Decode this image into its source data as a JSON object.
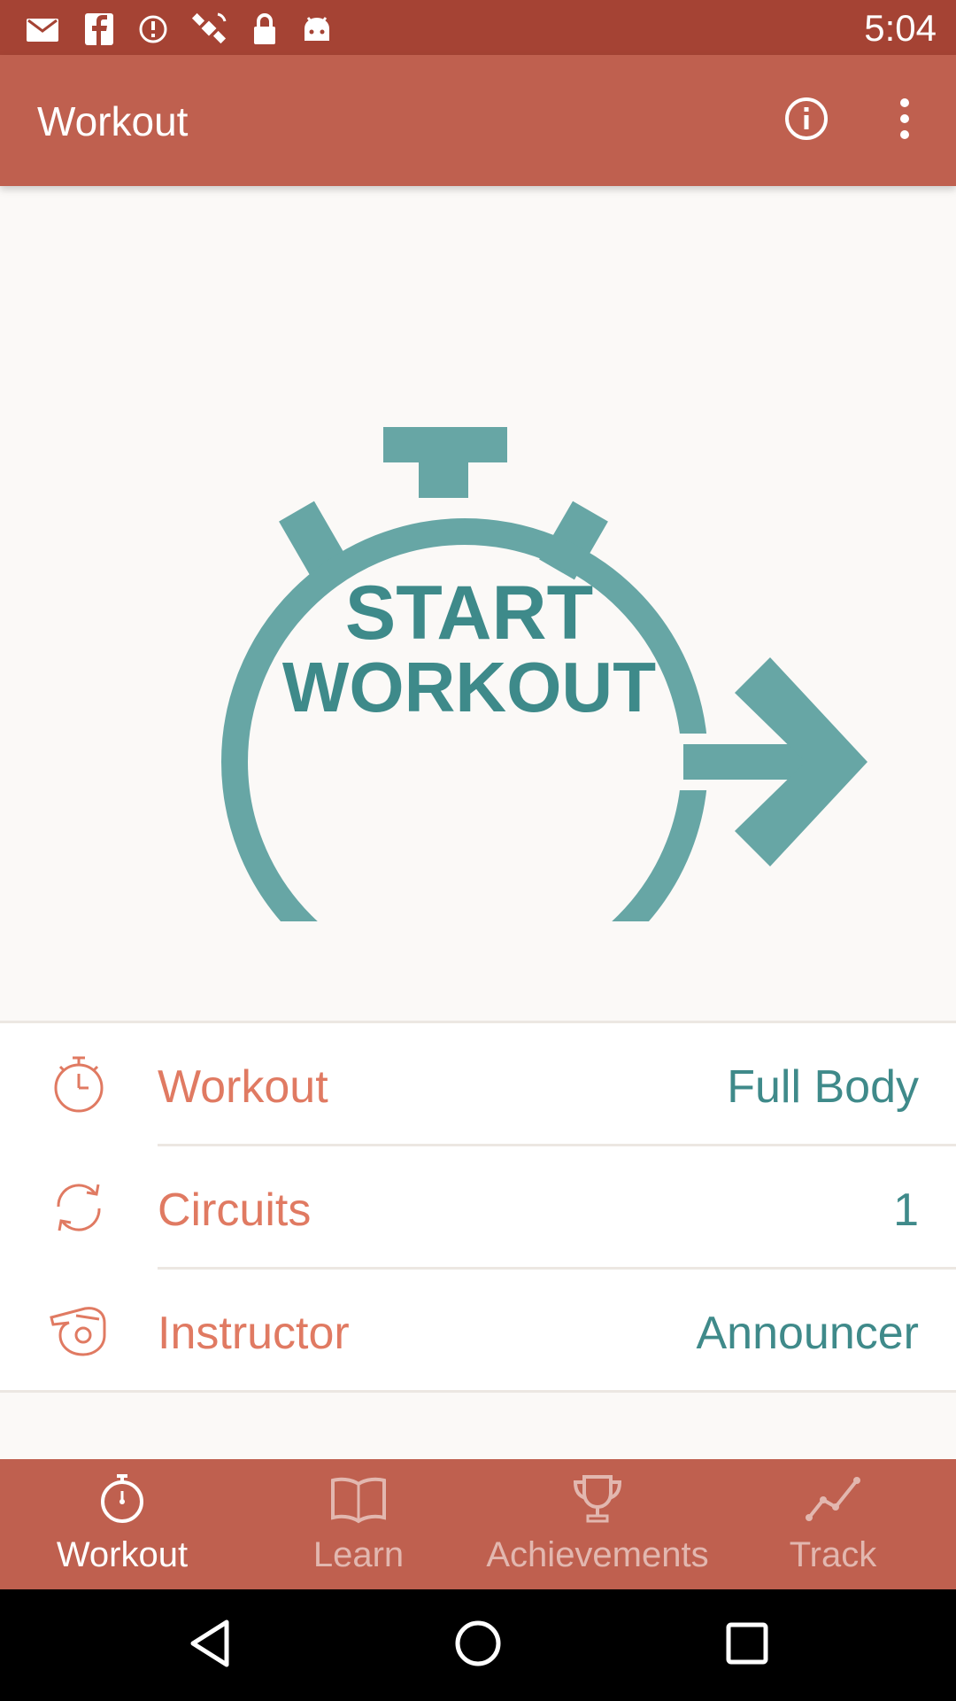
{
  "status_bar": {
    "time": "5:04",
    "icons": [
      "mail-icon",
      "facebook-icon",
      "fake-gps-icon",
      "satellite-icon",
      "lock-icon",
      "android-icon",
      "wifi-icon",
      "signal-icon",
      "battery-icon"
    ],
    "background": "#a54334"
  },
  "app_bar": {
    "title": "Workout",
    "background": "#bf604f",
    "actions": [
      "info-icon",
      "more-vert-icon"
    ]
  },
  "hero": {
    "start_line1": "START",
    "start_line2": "WORKOUT",
    "color": "#67a6a5"
  },
  "settings": [
    {
      "label": "Workout",
      "value": "Full Body",
      "icon": "stopwatch-icon"
    },
    {
      "label": "Circuits",
      "value": "1",
      "icon": "refresh-icon"
    },
    {
      "label": "Instructor",
      "value": "Announcer",
      "icon": "whistle-icon"
    }
  ],
  "bottom_nav": [
    {
      "label": "Workout",
      "icon": "stopwatch-icon",
      "active": true
    },
    {
      "label": "Learn",
      "icon": "book-icon",
      "active": false
    },
    {
      "label": "Achievements",
      "icon": "trophy-icon",
      "active": false
    },
    {
      "label": "Track",
      "icon": "chart-line-icon",
      "active": false
    }
  ],
  "colors": {
    "accent": "#e07a62",
    "teal": "#3f8a8a",
    "primary": "#bf604f"
  }
}
